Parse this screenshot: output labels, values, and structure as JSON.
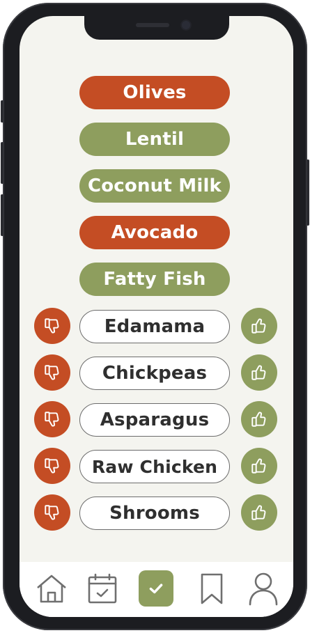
{
  "foods": [
    {
      "label": "Olives",
      "status": "red"
    },
    {
      "label": "Lentil",
      "status": "green"
    },
    {
      "label": "Coconut Milk",
      "status": "green"
    },
    {
      "label": "Avocado",
      "status": "red"
    },
    {
      "label": "Fatty Fish",
      "status": "green"
    }
  ],
  "pending": [
    {
      "label": "Edamama"
    },
    {
      "label": "Chickpeas"
    },
    {
      "label": "Asparagus"
    },
    {
      "label": "Raw Chicken"
    },
    {
      "label": "Shrooms"
    }
  ],
  "colors": {
    "dislike": "#c44d24",
    "like": "#8e9e5e",
    "background": "#f4f4ef"
  },
  "tabs": [
    {
      "icon": "home-icon"
    },
    {
      "icon": "calendar-check-icon"
    },
    {
      "icon": "check-icon",
      "active": true
    },
    {
      "icon": "bookmark-icon"
    },
    {
      "icon": "profile-icon"
    }
  ]
}
